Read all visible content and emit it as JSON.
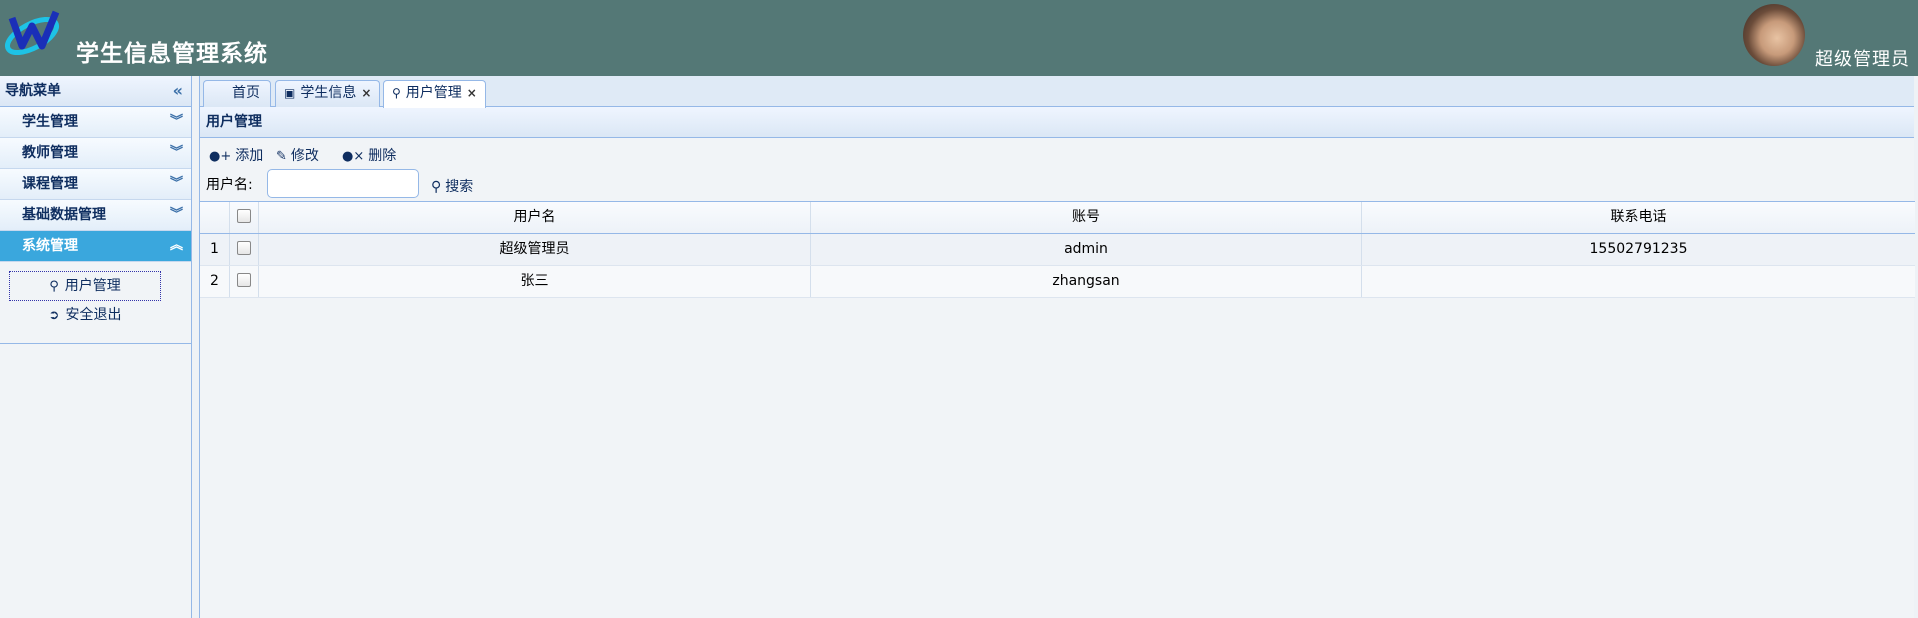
{
  "header": {
    "app_title": "学生信息管理系统",
    "user_role": "超级管理员",
    "logo_icon": "w-logo-icon",
    "colors": {
      "header_bg": "#547876",
      "active_menu": "#3aa7dd",
      "border": "#95b8e7"
    }
  },
  "sidebar": {
    "title": "导航菜单",
    "menus": [
      {
        "label": "学生管理"
      },
      {
        "label": "教师管理"
      },
      {
        "label": "课程管理"
      },
      {
        "label": "基础数据管理"
      },
      {
        "label": "系统管理"
      }
    ],
    "submenu": [
      {
        "label": "用户管理",
        "icon": "user-icon"
      },
      {
        "label": "安全退出",
        "icon": "logout-icon"
      }
    ]
  },
  "tabs": [
    {
      "label": "首页"
    },
    {
      "label": "学生信息",
      "icon": "contact-card-icon"
    },
    {
      "label": "用户管理",
      "icon": "user-icon"
    }
  ],
  "panel": {
    "title": "用户管理",
    "toolbar": {
      "add": "添加",
      "edit": "修改",
      "delete": "删除"
    },
    "search": {
      "label": "用户名:",
      "value": "",
      "placeholder": "",
      "button": "搜索"
    }
  },
  "grid": {
    "columns": [
      "用户名",
      "账号",
      "联系电话"
    ],
    "rows": [
      {
        "num": "1",
        "name": "超级管理员",
        "account": "admin",
        "phone": "15502791235"
      },
      {
        "num": "2",
        "name": "张三",
        "account": "zhangsan",
        "phone": ""
      }
    ]
  }
}
